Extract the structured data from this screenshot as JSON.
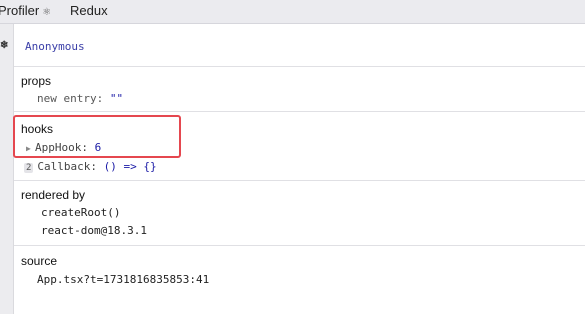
{
  "tabs": [
    {
      "label": "Profiler",
      "icon": "atom-icon"
    },
    {
      "label": "Redux"
    }
  ],
  "component": {
    "name": "Anonymous"
  },
  "props": {
    "title": "props",
    "items": [
      {
        "key": "new entry",
        "value": "\"\""
      }
    ]
  },
  "hooks": {
    "title": "hooks",
    "items": [
      {
        "name": "AppHook",
        "value": "6"
      },
      {
        "index": "2",
        "name": "Callback",
        "value": "() => {}"
      }
    ]
  },
  "rendered_by": {
    "title": "rendered by",
    "items": [
      "createRoot()",
      "react-dom@18.3.1"
    ]
  },
  "source": {
    "title": "source",
    "location": "App.tsx?t=1731816835853:41"
  },
  "annotation": {
    "color": "#e5474f"
  }
}
